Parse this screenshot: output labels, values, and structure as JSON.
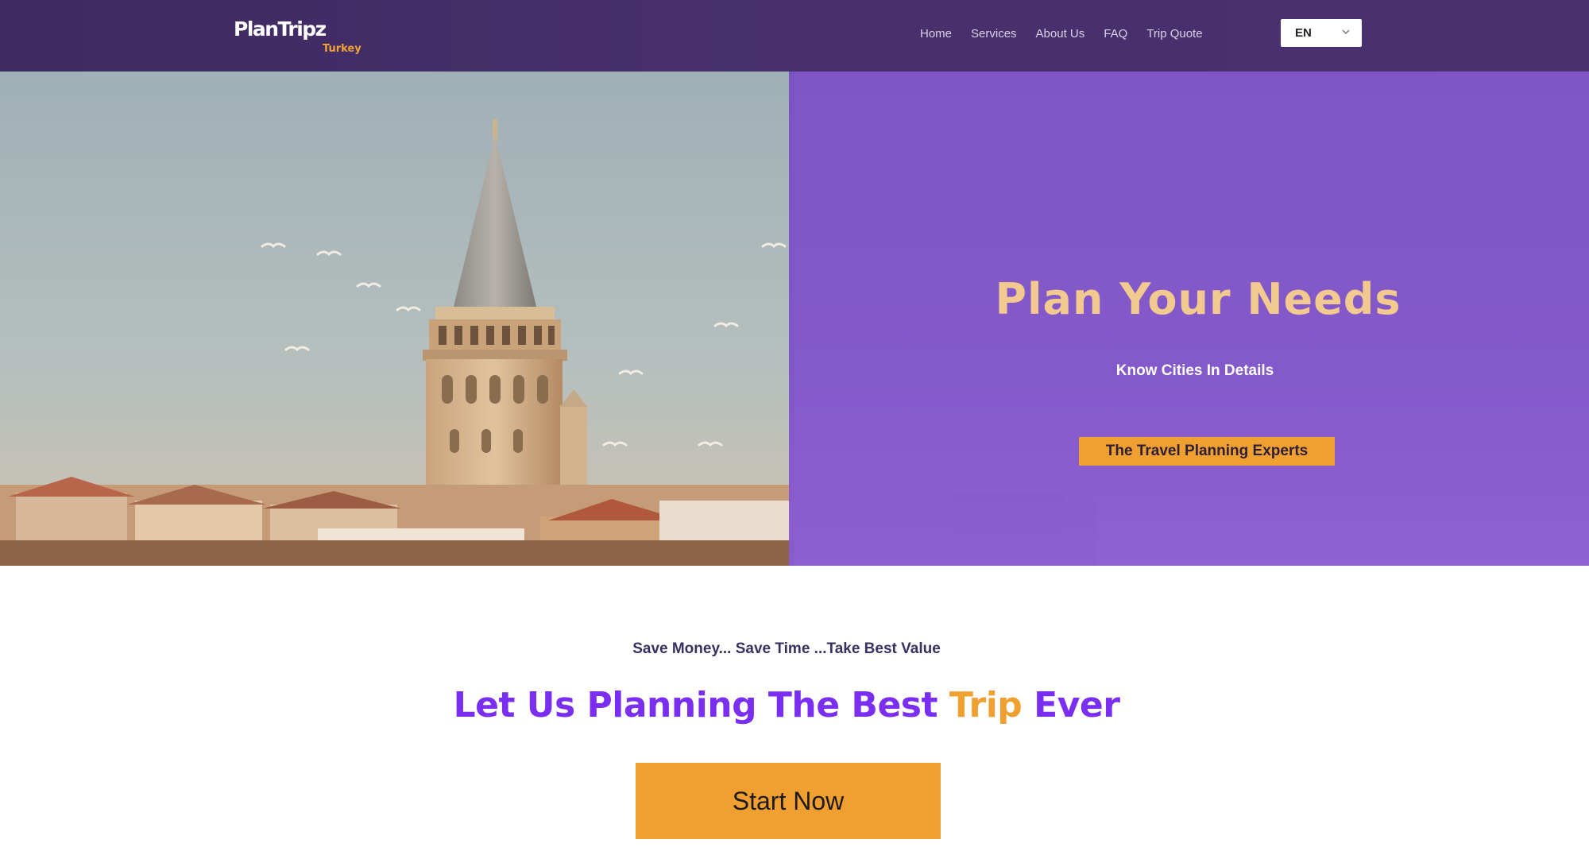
{
  "brand": {
    "name": "PlanTripz",
    "sub": "Turkey",
    "accent_color": "#f0a434",
    "primary_color": "#7a2ff0",
    "nav_bg": "#45306b"
  },
  "nav": {
    "items": [
      {
        "label": "Home"
      },
      {
        "label": "Services"
      },
      {
        "label": "About Us"
      },
      {
        "label": "FAQ"
      },
      {
        "label": "Trip Quote"
      }
    ],
    "language": {
      "selected": "EN",
      "icon": "chevron-down-icon"
    }
  },
  "hero": {
    "title": "Plan Your Needs",
    "subtitle": "Know Cities In Details",
    "badge": "The Travel Planning Experts"
  },
  "cta": {
    "tagline": "Save Money... Save Time ...Take Best Value",
    "headline": {
      "part1": "Let Us Planning The Best ",
      "accent": "Trip",
      "part2": " Ever"
    },
    "button_label": "Start Now"
  }
}
